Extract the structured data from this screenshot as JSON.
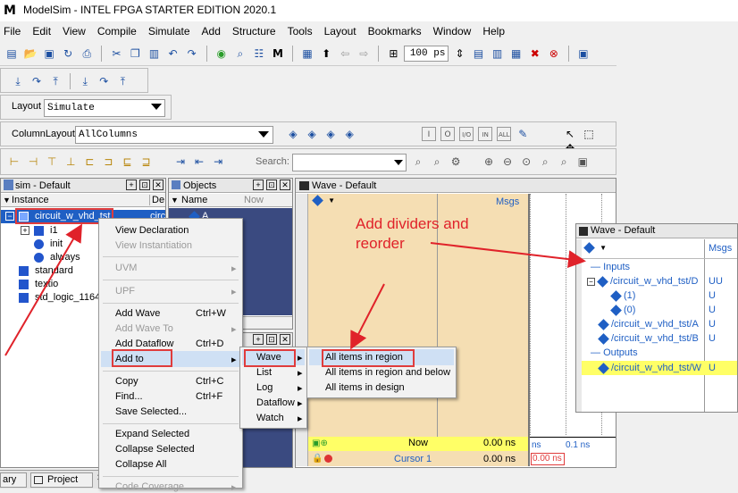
{
  "window": {
    "title": "ModelSim - INTEL FPGA STARTER EDITION 2020.1"
  },
  "menu": [
    "File",
    "Edit",
    "View",
    "Compile",
    "Simulate",
    "Add",
    "Structure",
    "Tools",
    "Layout",
    "Bookmarks",
    "Window",
    "Help"
  ],
  "toolbar": {
    "time_value": "100 ps",
    "layout_label": "Layout",
    "layout_value": "Simulate",
    "columnlayout_label": "ColumnLayout",
    "columnlayout_value": "AllColumns",
    "search_label": "Search:"
  },
  "sim_panel": {
    "title": "sim - Default",
    "col_instance": "Instance",
    "col_design": "De",
    "items": [
      "circuit_w_vhd_tst",
      "i1",
      "init",
      "always",
      "standard",
      "textio",
      "std_logic_1164"
    ],
    "design_unit": "circ"
  },
  "objects_panel": {
    "title": "Objects",
    "col_name": "Name",
    "col_now": "Now",
    "item": "A"
  },
  "wave_panel": {
    "title": "Wave - Default",
    "col_msgs": "Msgs",
    "now_label": "Now",
    "now_value": "0.00 ns",
    "cursor_label": "Cursor 1",
    "cursor_value": "0.00 ns",
    "cursor_box": "0.00 ns",
    "ruler": [
      "ns",
      "0.1 ns"
    ]
  },
  "context_menu": [
    {
      "label": "View Declaration",
      "shortcut": "",
      "disabled": false
    },
    {
      "label": "View Instantiation",
      "shortcut": "",
      "disabled": true
    },
    {
      "label": "UVM",
      "shortcut": "",
      "disabled": true
    },
    {
      "label": "UPF",
      "shortcut": "",
      "disabled": true
    },
    {
      "label": "Add Wave",
      "shortcut": "Ctrl+W",
      "disabled": false
    },
    {
      "label": "Add Wave To",
      "shortcut": "",
      "disabled": true
    },
    {
      "label": "Add Dataflow",
      "shortcut": "Ctrl+D",
      "disabled": false
    },
    {
      "label": "Add to",
      "shortcut": "",
      "disabled": false
    },
    {
      "label": "Copy",
      "shortcut": "Ctrl+C",
      "disabled": false
    },
    {
      "label": "Find...",
      "shortcut": "Ctrl+F",
      "disabled": false
    },
    {
      "label": "Save Selected...",
      "shortcut": "",
      "disabled": false
    },
    {
      "label": "Expand Selected",
      "shortcut": "",
      "disabled": false
    },
    {
      "label": "Collapse Selected",
      "shortcut": "",
      "disabled": false
    },
    {
      "label": "Collapse All",
      "shortcut": "",
      "disabled": false
    },
    {
      "label": "Code Coverage",
      "shortcut": "",
      "disabled": true
    }
  ],
  "submenu_addto": [
    "Wave",
    "List",
    "Log",
    "Dataflow",
    "Watch"
  ],
  "submenu_wave": [
    "All items in region",
    "All items in region and below",
    "All items in design"
  ],
  "bottom_tabs": [
    "ary",
    "Project"
  ],
  "annotation": {
    "line1": "Add dividers and",
    "line2": "reorder"
  },
  "inset_wave": {
    "title": "Wave - Default",
    "col_msgs": "Msgs",
    "rows": [
      {
        "name": "Inputs",
        "value": "",
        "type": "divider"
      },
      {
        "name": "/circuit_w_vhd_tst/D",
        "value": "UU",
        "type": "bus"
      },
      {
        "name": "(1)",
        "value": "U",
        "type": "bit"
      },
      {
        "name": "(0)",
        "value": "U",
        "type": "bit"
      },
      {
        "name": "/circuit_w_vhd_tst/A",
        "value": "U",
        "type": "sig"
      },
      {
        "name": "/circuit_w_vhd_tst/B",
        "value": "U",
        "type": "sig"
      },
      {
        "name": "Outputs",
        "value": "",
        "type": "divider"
      },
      {
        "name": "/circuit_w_vhd_tst/W",
        "value": "U",
        "type": "sig"
      }
    ]
  },
  "colors": {
    "accent_red": "#e03c3c",
    "wave_bg": "#f5deb3",
    "highlight_yellow": "#ffff66",
    "select_blue": "#1f5fc4"
  }
}
